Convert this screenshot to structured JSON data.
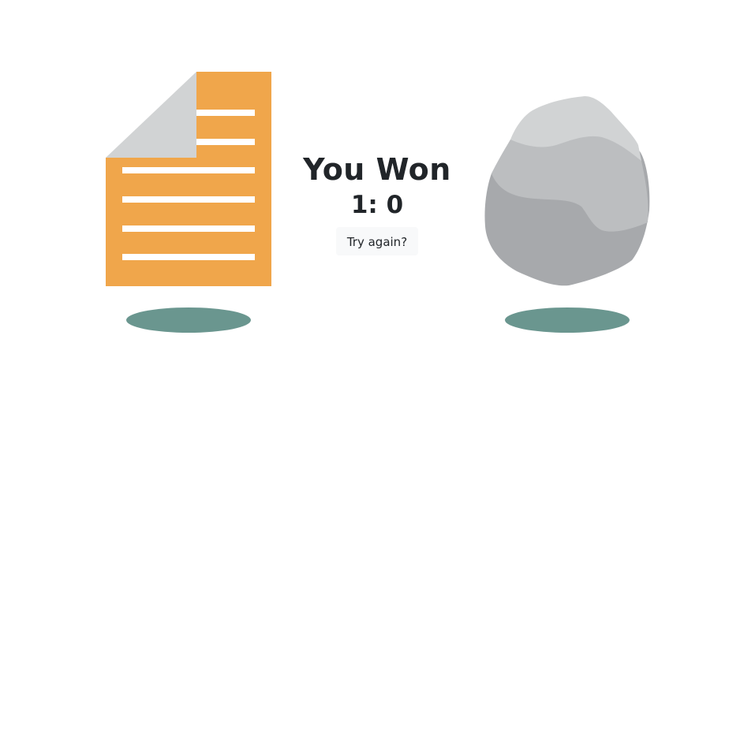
{
  "game": {
    "result_title": "You Won",
    "score": "1: 0",
    "retry_label": "Try again?",
    "player_choice": "paper-icon",
    "computer_choice": "rock-icon"
  },
  "colors": {
    "paper": "#f0a64b",
    "paper_fold": "#d1d3d4",
    "paper_lines": "#ffffff",
    "rock_light": "#d1d3d4",
    "rock_mid": "#bcbec0",
    "rock_dark": "#a7a9ac",
    "shadow": "#6a968f",
    "button_bg": "#f8f9fa",
    "text": "#212529"
  }
}
